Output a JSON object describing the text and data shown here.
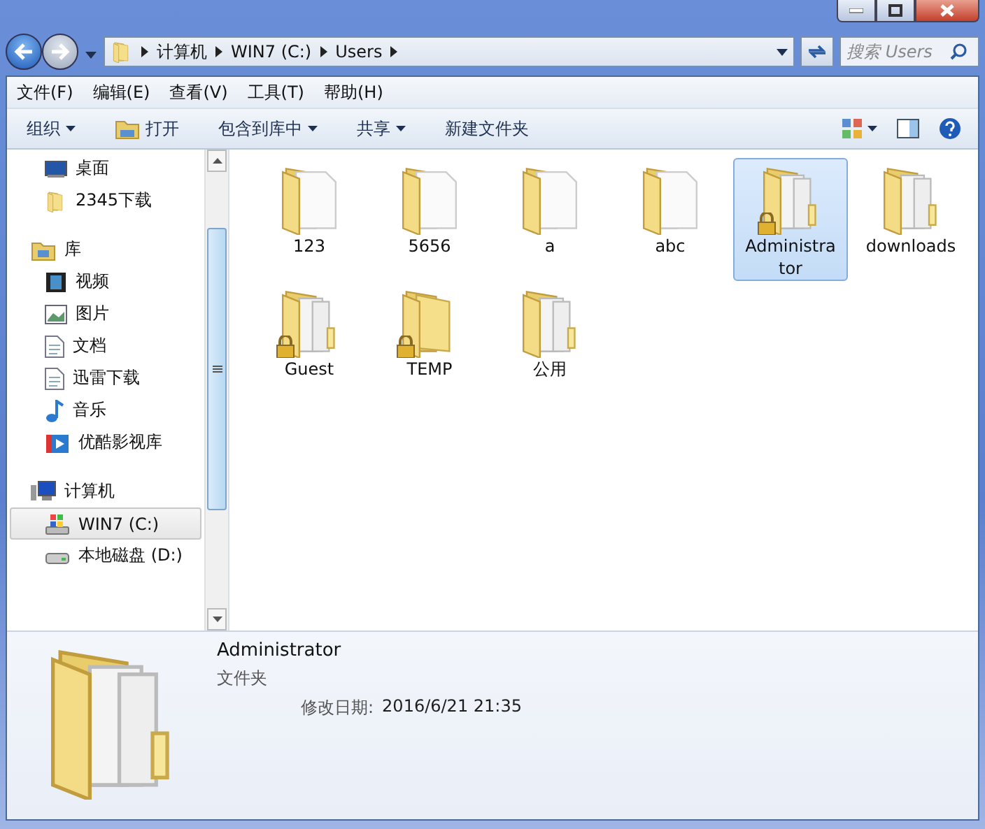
{
  "address_bar": {
    "crumbs": [
      "计算机",
      "WIN7 (C:)",
      "Users"
    ]
  },
  "search": {
    "placeholder": "搜索 Users"
  },
  "menu_bar": [
    "文件(F)",
    "编辑(E)",
    "查看(V)",
    "工具(T)",
    "帮助(H)"
  ],
  "toolbar": [
    {
      "label": "组织",
      "kind": "dropdown"
    },
    {
      "label": "打开",
      "kind": "icon"
    },
    {
      "label": "包含到库中",
      "kind": "dropdown"
    },
    {
      "label": "共享",
      "kind": "dropdown"
    },
    {
      "label": "新建文件夹",
      "kind": "plain"
    }
  ],
  "navigation": [
    {
      "label": "桌面",
      "kind": "desktop",
      "selected": false
    },
    {
      "label": "2345下载",
      "kind": "folder",
      "selected": false
    },
    {
      "label": "库",
      "kind": "library",
      "selected": false,
      "children": [
        {
          "label": "视频",
          "kind": "video",
          "selected": false
        },
        {
          "label": "图片",
          "kind": "picture",
          "selected": false
        },
        {
          "label": "文档",
          "kind": "document",
          "selected": false
        },
        {
          "label": "迅雷下载",
          "kind": "document",
          "selected": false
        },
        {
          "label": "音乐",
          "kind": "music",
          "selected": false
        },
        {
          "label": "优酷影视库",
          "kind": "video-lib",
          "selected": false
        }
      ]
    },
    {
      "label": "计算机",
      "kind": "computer",
      "selected": false,
      "children": [
        {
          "label": "WIN7 (C:)",
          "kind": "system-drive",
          "selected": true
        },
        {
          "label": "本地磁盘 (D:)",
          "kind": "drive",
          "selected": false
        }
      ]
    }
  ],
  "folders": [
    {
      "name": "123",
      "kind": "document",
      "locked": false,
      "selected": false
    },
    {
      "name": "5656",
      "kind": "document",
      "locked": false,
      "selected": false
    },
    {
      "name": "a",
      "kind": "document",
      "locked": false,
      "selected": false
    },
    {
      "name": "abc",
      "kind": "document",
      "locked": false,
      "selected": false
    },
    {
      "name": "Administrator",
      "kind": "files",
      "locked": true,
      "selected": true
    },
    {
      "name": "downloads",
      "kind": "files",
      "locked": false,
      "selected": false
    },
    {
      "name": "Guest",
      "kind": "files",
      "locked": true,
      "selected": false
    },
    {
      "name": "TEMP",
      "kind": "empty",
      "locked": true,
      "selected": false
    },
    {
      "name": "公用",
      "kind": "files",
      "locked": false,
      "selected": false
    }
  ],
  "details": {
    "name": "Administrator",
    "type": "文件夹",
    "date_label": "修改日期:",
    "date_value": "2016/6/21 21:35"
  }
}
